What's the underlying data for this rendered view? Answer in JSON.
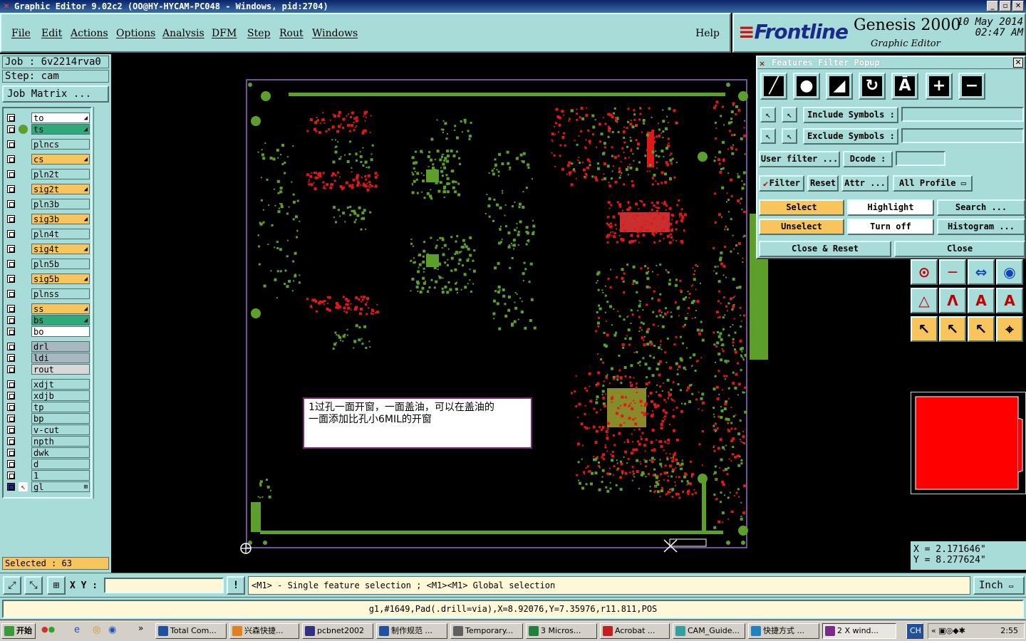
{
  "window": {
    "title": "Graphic Editor 9.02c2  (OO@HY-HYCAM-PC048 - Windows, pid:2704)"
  },
  "menu": [
    "File",
    "Edit",
    "Actions",
    "Options",
    "Analysis",
    "DFM",
    "Step",
    "Rout",
    "Windows"
  ],
  "help_label": "Help",
  "brand": {
    "logo": "Frontline",
    "product": "Genesis 2000",
    "subtitle": "Graphic Editor",
    "date": "10 May 2014",
    "time": "02:47 AM"
  },
  "job": {
    "job_label": "Job : 6v2214rva0",
    "step_label": "Step: cam",
    "matrix_button": "Job Matrix ..."
  },
  "layers": [
    {
      "name": "to",
      "bg": "#ffffff",
      "arrow": true
    },
    {
      "name": "ts",
      "bg": "#2fa87a",
      "arrow": true,
      "dot": true
    },
    {
      "name": "plncs",
      "bg": "#a8dcd8"
    },
    {
      "name": "cs",
      "bg": "#f8c45c",
      "arrow": true
    },
    {
      "name": "pln2t",
      "bg": "#a8dcd8"
    },
    {
      "name": "sig2t",
      "bg": "#f8c45c",
      "arrow": true
    },
    {
      "name": "pln3b",
      "bg": "#a8dcd8"
    },
    {
      "name": "sig3b",
      "bg": "#f8c45c",
      "arrow": true
    },
    {
      "name": "pln4t",
      "bg": "#a8dcd8"
    },
    {
      "name": "sig4t",
      "bg": "#f8c45c",
      "arrow": true
    },
    {
      "name": "pln5b",
      "bg": "#a8dcd8"
    },
    {
      "name": "sig5b",
      "bg": "#f8c45c",
      "arrow": true
    },
    {
      "name": "plnss",
      "bg": "#a8dcd8"
    },
    {
      "name": "ss",
      "bg": "#f8c45c",
      "arrow": true
    },
    {
      "name": "bs",
      "bg": "#2fa87a",
      "arrow": true
    },
    {
      "name": "bo",
      "bg": "#ffffff"
    },
    {
      "name": "drl",
      "bg": "#a8b8c0"
    },
    {
      "name": "ldi",
      "bg": "#a8b8c0"
    },
    {
      "name": "rout",
      "bg": "#d8d8d8"
    },
    {
      "name": "xdjt",
      "bg": "#a8dcd8"
    },
    {
      "name": "xdjb",
      "bg": "#a8dcd8"
    },
    {
      "name": "tp",
      "bg": "#a8dcd8"
    },
    {
      "name": "bp",
      "bg": "#a8dcd8"
    },
    {
      "name": "v-cut",
      "bg": "#a8dcd8"
    },
    {
      "name": "npth",
      "bg": "#a8dcd8"
    },
    {
      "name": "dwk",
      "bg": "#a8dcd8"
    },
    {
      "name": "d",
      "bg": "#a8dcd8"
    },
    {
      "name": "1",
      "bg": "#a8dcd8"
    },
    {
      "name": "gl",
      "bg": "#a8dcd8",
      "active": true
    }
  ],
  "selected_label": "Selected : 63",
  "note": {
    "line1": "1过孔一面开窗，一面盖油，可以在盖油的",
    "line2": "一面添加比孔小6MIL的开窗"
  },
  "filter_popup": {
    "title": "Features Filter Popup",
    "include_label": "Include Symbols :",
    "exclude_label": "Exclude Symbols :",
    "user_filter": "User filter ...",
    "dcode": "Dcode :",
    "filter_label": "Filter",
    "reset": "Reset",
    "attr": "Attr ...",
    "profile": "All Profile",
    "select": "Select",
    "highlight": "Highlight",
    "search": "Search ...",
    "unselect": "Unselect",
    "turn_off": "Turn off",
    "histogram": "Histogram ...",
    "close_reset": "Close & Reset",
    "close": "Close"
  },
  "coords": {
    "x": "X = 2.171646\"",
    "y": "Y = 8.277624\""
  },
  "bottom": {
    "xy_label": "X Y :",
    "hint": "<M1> - Single feature selection ; <M1><M1> Global selection",
    "unit": "Inch",
    "status": "g1,#1649,Pad(.drill=via),X=8.92076,Y=7.35976,r11.811,POS"
  },
  "taskbar": {
    "start": "开始",
    "items": [
      "Total Com...",
      "兴森快捷...",
      "pcbnet2002",
      "制作规范 ...",
      "Temporary...",
      "3 Micros...",
      "Acrobat ...",
      "CAM_Guide...",
      "快捷方式 ...",
      "2 X wind..."
    ],
    "lang": "CH",
    "clock": "2:55"
  },
  "colors": {
    "panel": "#a8dcd8",
    "highlight": "#f8c45c",
    "pcb_green": "#5c9f2a",
    "pcb_red": "#e01818",
    "profile": "#9a6ad0"
  }
}
